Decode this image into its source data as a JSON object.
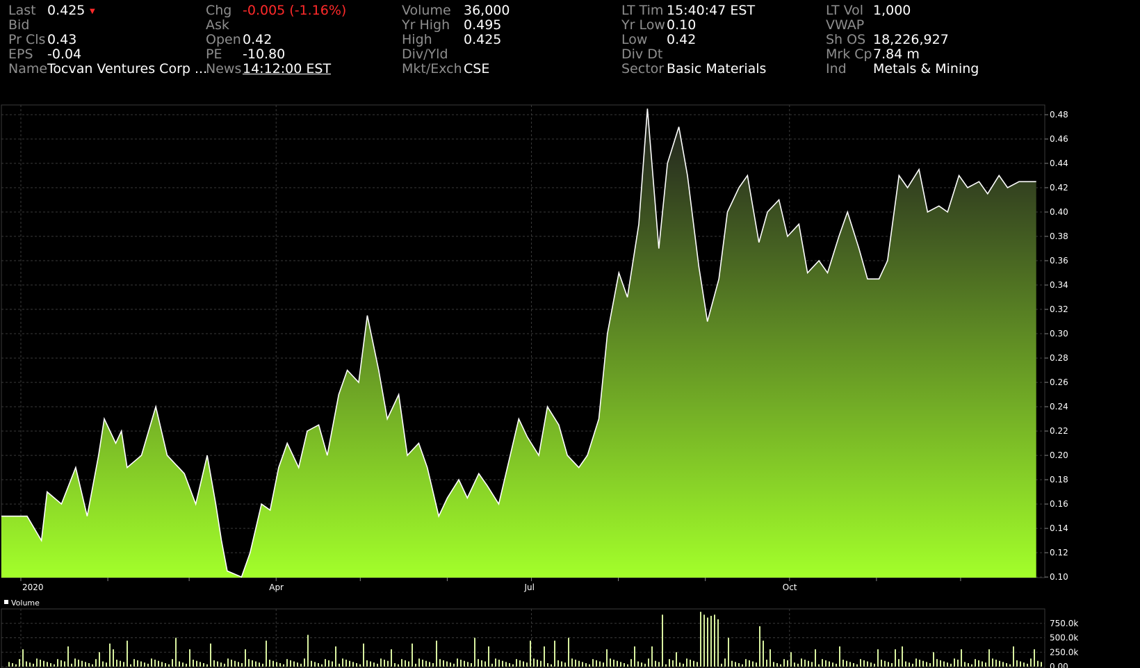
{
  "quote": {
    "last": {
      "label": "Last",
      "value": "0.425"
    },
    "chg": {
      "label": "Chg",
      "value": "-0.005 (-1.16%)"
    },
    "volume": {
      "label": "Volume",
      "value": "36,000"
    },
    "lt_time": {
      "label": "LT Tim",
      "value": "15:40:47 EST"
    },
    "lt_vol": {
      "label": "LT Vol",
      "value": "1,000"
    },
    "bid": {
      "label": "Bid",
      "value": ""
    },
    "ask": {
      "label": "Ask",
      "value": ""
    },
    "yr_high": {
      "label": "Yr High",
      "value": "0.495"
    },
    "yr_low": {
      "label": "Yr Low",
      "value": "0.10"
    },
    "vwap": {
      "label": "VWAP",
      "value": ""
    },
    "pr_cls": {
      "label": "Pr Cls",
      "value": "0.43"
    },
    "open": {
      "label": "Open",
      "value": "0.42"
    },
    "high": {
      "label": "High",
      "value": "0.425"
    },
    "low": {
      "label": "Low",
      "value": "0.42"
    },
    "sh_os": {
      "label": "Sh OS",
      "value": "18,226,927"
    },
    "eps": {
      "label": "EPS",
      "value": "-0.04"
    },
    "pe": {
      "label": "PE",
      "value": "-10.80"
    },
    "div_yld": {
      "label": "Div/Yld",
      "value": ""
    },
    "div_dt": {
      "label": "Div Dt",
      "value": ""
    },
    "mrk_cp": {
      "label": "Mrk Cp",
      "value": "7.84 m"
    },
    "name": {
      "label": "Name",
      "value": "Tocvan Ventures Corp ..."
    },
    "news": {
      "label": "News",
      "value": "14:12:00 EST"
    },
    "mkt_exch": {
      "label": "Mkt/Exch",
      "value": "CSE"
    },
    "sector": {
      "label": "Sector",
      "value": "Basic Materials"
    },
    "ind": {
      "label": "Ind",
      "value": "Metals & Mining"
    }
  },
  "colors": {
    "background": "#000000",
    "line": "#ffffff",
    "fill_top": "#1e1e1e",
    "fill_bottom": "#a3ff2a",
    "volume_bar": "#d9f2a0",
    "negative": "#ff2a2a",
    "label": "#8e8e8e",
    "grid": "#3a3a3a"
  },
  "chart_data": [
    {
      "type": "area",
      "x_tick_labels": [
        "2020",
        "Apr",
        "Jul",
        "Oct"
      ],
      "y_ticks": [
        0.1,
        0.12,
        0.14,
        0.16,
        0.18,
        0.2,
        0.22,
        0.24,
        0.26,
        0.28,
        0.3,
        0.32,
        0.34,
        0.36,
        0.38,
        0.4,
        0.42,
        0.44,
        0.46,
        0.48
      ],
      "ylim": [
        0.0995,
        0.488
      ],
      "x": [
        "2020-01-01",
        "2020-01-10",
        "2020-01-15",
        "2020-01-17",
        "2020-01-22",
        "2020-01-27",
        "2020-01-31",
        "2020-02-04",
        "2020-02-06",
        "2020-02-10",
        "2020-02-12",
        "2020-02-14",
        "2020-02-19",
        "2020-02-24",
        "2020-02-28",
        "2020-03-03",
        "2020-03-05",
        "2020-03-09",
        "2020-03-13",
        "2020-03-16",
        "2020-03-18",
        "2020-03-20",
        "2020-03-25",
        "2020-03-28",
        "2020-04-01",
        "2020-04-04",
        "2020-04-07",
        "2020-04-10",
        "2020-04-14",
        "2020-04-17",
        "2020-04-21",
        "2020-04-24",
        "2020-04-28",
        "2020-05-01",
        "2020-05-05",
        "2020-05-08",
        "2020-05-12",
        "2020-05-15",
        "2020-05-19",
        "2020-05-22",
        "2020-05-26",
        "2020-05-29",
        "2020-06-02",
        "2020-06-05",
        "2020-06-09",
        "2020-06-12",
        "2020-06-16",
        "2020-06-19",
        "2020-06-23",
        "2020-06-26",
        "2020-06-30",
        "2020-07-03",
        "2020-07-07",
        "2020-07-10",
        "2020-07-14",
        "2020-07-17",
        "2020-07-21",
        "2020-07-24",
        "2020-07-28",
        "2020-07-31",
        "2020-08-04",
        "2020-08-07",
        "2020-08-11",
        "2020-08-14",
        "2020-08-18",
        "2020-08-21",
        "2020-08-25",
        "2020-08-28",
        "2020-09-01",
        "2020-09-04",
        "2020-09-08",
        "2020-09-11",
        "2020-09-15",
        "2020-09-18",
        "2020-09-22",
        "2020-09-25",
        "2020-09-29",
        "2020-10-02",
        "2020-10-06",
        "2020-10-09",
        "2020-10-13",
        "2020-10-16",
        "2020-10-20",
        "2020-10-23",
        "2020-10-27",
        "2020-10-30",
        "2020-11-03",
        "2020-11-06",
        "2020-11-10",
        "2020-11-13",
        "2020-11-17",
        "2020-11-20",
        "2020-11-24",
        "2020-11-27",
        "2020-12-01",
        "2020-12-04",
        "2020-12-08",
        "2020-12-11",
        "2020-12-15",
        "2020-12-18",
        "2020-12-22",
        "2020-12-28"
      ],
      "series": [
        {
          "values": [
            0.15,
            0.15,
            0.13,
            0.17,
            0.16,
            0.19,
            0.15,
            0.2,
            0.23,
            0.21,
            0.22,
            0.19,
            0.2,
            0.24,
            0.2,
            0.19,
            0.185,
            0.16,
            0.2,
            0.16,
            0.13,
            0.105,
            0.1,
            0.12,
            0.16,
            0.155,
            0.19,
            0.21,
            0.19,
            0.22,
            0.225,
            0.2,
            0.25,
            0.27,
            0.26,
            0.315,
            0.27,
            0.23,
            0.25,
            0.2,
            0.21,
            0.19,
            0.15,
            0.165,
            0.18,
            0.165,
            0.185,
            0.175,
            0.16,
            0.19,
            0.23,
            0.215,
            0.2,
            0.24,
            0.225,
            0.2,
            0.19,
            0.2,
            0.23,
            0.3,
            0.35,
            0.33,
            0.39,
            0.485,
            0.37,
            0.44,
            0.47,
            0.43,
            0.355,
            0.31,
            0.345,
            0.4,
            0.42,
            0.43,
            0.375,
            0.4,
            0.41,
            0.38,
            0.39,
            0.35,
            0.36,
            0.35,
            0.38,
            0.4,
            0.37,
            0.345,
            0.345,
            0.36,
            0.43,
            0.42,
            0.435,
            0.4,
            0.405,
            0.4,
            0.43,
            0.42,
            0.425,
            0.415,
            0.43,
            0.42,
            0.425,
            0.425
          ]
        }
      ]
    },
    {
      "type": "bar",
      "legend": "Volume",
      "y_tick_labels": [
        "750.0k",
        "500.0k",
        "250.0k",
        "0.00"
      ],
      "y_ticks": [
        750000,
        500000,
        250000,
        0
      ],
      "ylim": [
        0,
        1000000
      ]
    }
  ]
}
